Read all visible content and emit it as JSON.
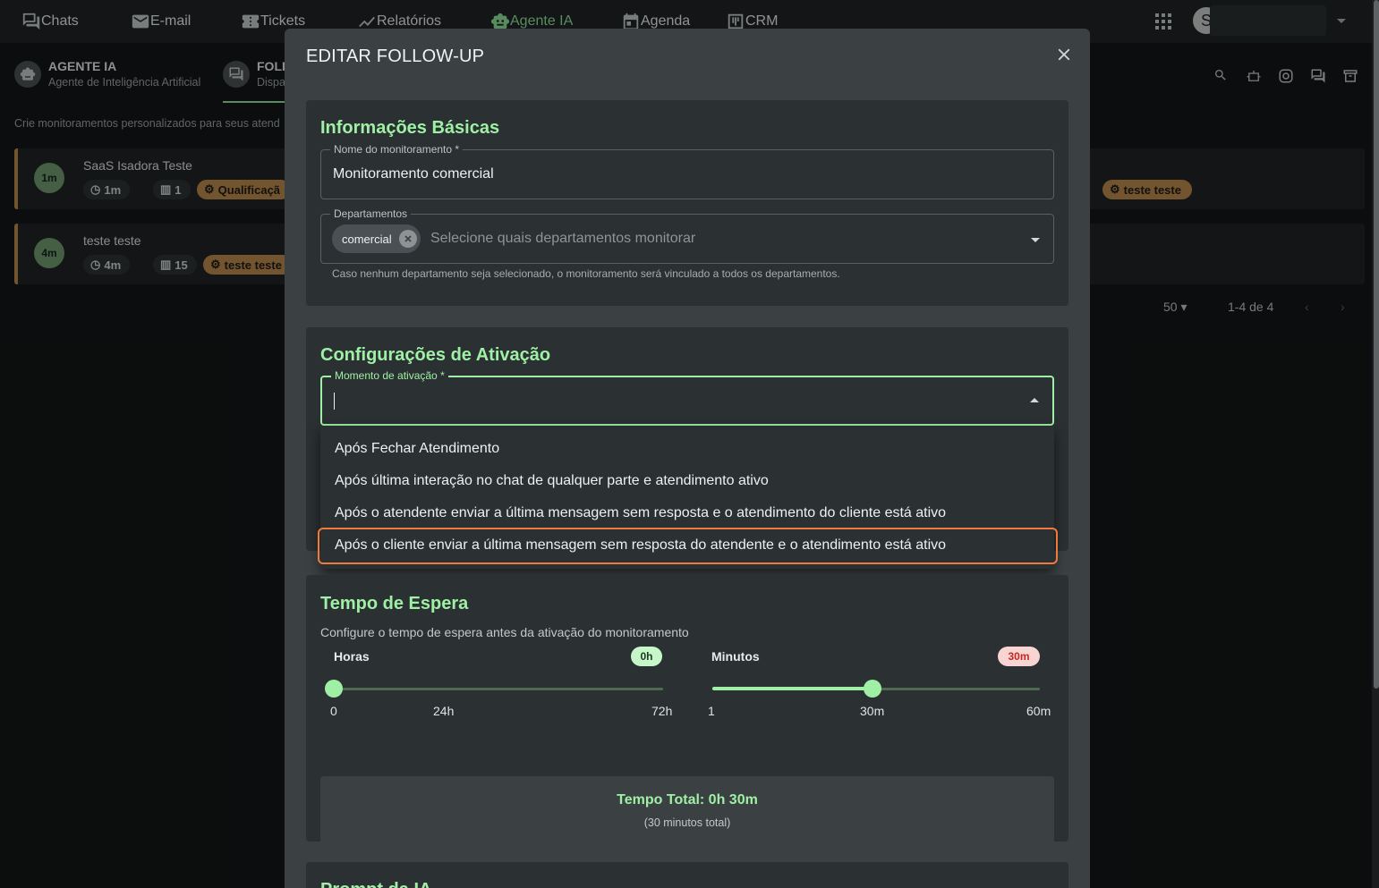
{
  "topbar": {
    "nav": [
      {
        "label": "Chats",
        "icon": "chat-icon"
      },
      {
        "label": "E-mail",
        "icon": "mail-icon"
      },
      {
        "label": "Tickets",
        "icon": "ticket-icon"
      },
      {
        "label": "Relatórios",
        "icon": "chart-icon"
      },
      {
        "label": "Agente IA",
        "icon": "robot-icon"
      },
      {
        "label": "Agenda",
        "icon": "calendar-icon"
      },
      {
        "label": "CRM",
        "icon": "kanban-icon"
      }
    ],
    "avatar_initial": "S"
  },
  "subheader": {
    "agent_title": "AGENTE IA",
    "agent_desc": "Agente de Inteligência Artificial",
    "tab_title": "FOLL",
    "tab_desc": "Dispa",
    "intro": "Crie monitoramentos personalizados para seus atend"
  },
  "cards": [
    {
      "badge": "1m",
      "title": "SaaS Isadora Teste",
      "time": "1m",
      "count": "1",
      "tag": "Qualificaçã",
      "tag_right": "teste teste"
    },
    {
      "badge": "4m",
      "title": "teste teste",
      "time": "4m",
      "count": "15",
      "tag": "teste teste"
    }
  ],
  "pagination": {
    "per_page": "50",
    "range": "1-4 de 4"
  },
  "modal": {
    "title": "EDITAR FOLLOW-UP",
    "basic": {
      "title": "Informações Básicas",
      "name_label": "Nome do monitoramento *",
      "name_value": "Monitoramento comercial",
      "dept_label": "Departamentos",
      "dept_chip": "comercial",
      "dept_placeholder": "Selecione quais departamentos monitorar",
      "dept_helper": "Caso nenhum departamento seja selecionado, o monitoramento será vinculado a todos os departamentos."
    },
    "activation": {
      "title": "Configurações de Ativação",
      "moment_label": "Momento de ativação *",
      "options": [
        "Após Fechar Atendimento",
        "Após última interação no chat de qualquer parte e atendimento ativo",
        "Após o atendente enviar a última mensagem sem resposta e o atendimento do cliente está ativo",
        "Após o cliente enviar a última mensagem sem resposta do atendente e o atendimento está ativo"
      ]
    },
    "wait": {
      "title": "Tempo de Espera",
      "desc": "Configure o tempo de espera antes da ativação do monitoramento",
      "hours_label": "Horas",
      "hours_value": "0h",
      "hours_fraction": 0,
      "hours_ticks": [
        "0",
        "24h",
        "72h"
      ],
      "minutes_label": "Minutos",
      "minutes_value": "30m",
      "minutes_fraction": 0.49,
      "minutes_ticks": [
        "1",
        "30m",
        "60m"
      ],
      "total_main": "Tempo Total: 0h 30m",
      "total_sub": "(30 minutos total)"
    },
    "prompt": {
      "title": "Prompt da IA"
    }
  },
  "colors": {
    "accent": "#9ff0a5",
    "tag": "#b98a4d",
    "highlight": "#f07a3c",
    "minutes_pill": "#f8d4d2"
  }
}
